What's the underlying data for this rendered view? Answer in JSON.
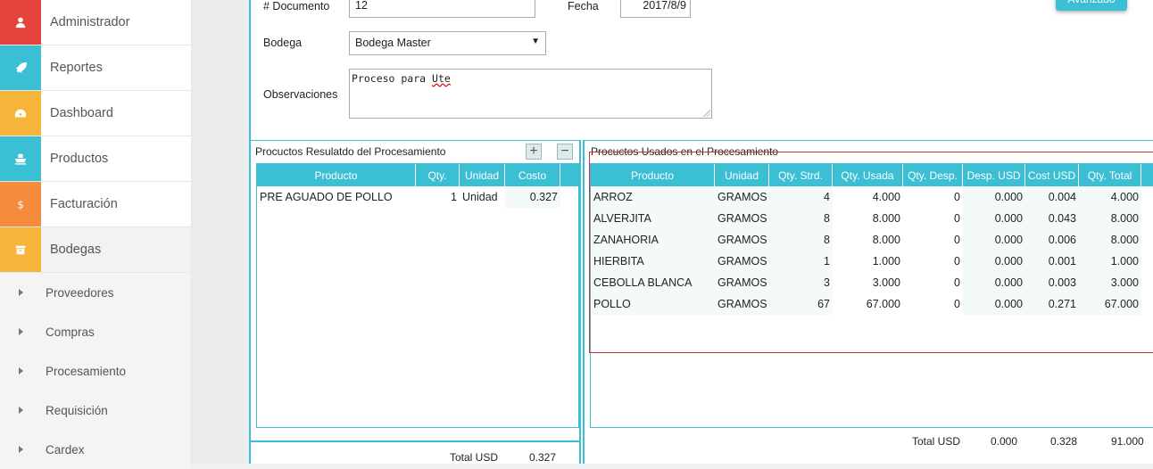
{
  "sidebar": {
    "items": [
      {
        "label": "Administrador",
        "icon": "user-icon",
        "color": "#e5443d"
      },
      {
        "label": "Reportes",
        "icon": "rocket-icon",
        "color": "#3bbfd4"
      },
      {
        "label": "Dashboard",
        "icon": "dashboard-icon",
        "color": "#f6b53a"
      },
      {
        "label": "Productos",
        "icon": "ship-icon",
        "color": "#3bbfd4"
      },
      {
        "label": "Facturación",
        "icon": "dollar-icon",
        "color": "#f58c3c"
      },
      {
        "label": "Bodegas",
        "icon": "archive-icon",
        "color": "#f6b53a"
      }
    ],
    "subitems": [
      "Proveedores",
      "Compras",
      "Procesamiento",
      "Requisición",
      "Cardex"
    ]
  },
  "form": {
    "documento_label": "# Documento",
    "documento_value": "12",
    "fecha_label": "Fecha",
    "fecha_value": "2017/8/9",
    "bodega_label": "Bodega",
    "bodega_value": "Bodega Master",
    "observaciones_label": "Observaciones",
    "observaciones_value_1": "Proceso para ",
    "observaciones_value_2": "Ute",
    "avanzado_label": "Avanzado"
  },
  "resultado": {
    "title": "Procuctos Resulatdo del Procesamiento",
    "add_symbol": "+",
    "remove_symbol": "−",
    "columns": [
      "Producto",
      "Qty.",
      "Unidad",
      "Costo"
    ],
    "rows": [
      {
        "producto": "PRE AGUADO DE POLLO",
        "qty": "1",
        "unidad": "Unidad",
        "costo": "0.327"
      }
    ],
    "total_label": "Total USD",
    "total_value": "0.327"
  },
  "usados": {
    "title": "Procuctos Usados en el Procesamiento",
    "columns": [
      "Producto",
      "Unidad",
      "Qty. Strd.",
      "Qty. Usada",
      "Qty. Desp.",
      "Desp. USD",
      "Cost USD",
      "Qty. Total"
    ],
    "rows": [
      {
        "producto": "ARROZ",
        "unidad": "GRAMOS",
        "strd": "4",
        "usada": "4.000",
        "desp": "0",
        "desp_usd": "0.000",
        "cost": "0.004",
        "total": "4.000"
      },
      {
        "producto": "ALVERJITA",
        "unidad": "GRAMOS",
        "strd": "8",
        "usada": "8.000",
        "desp": "0",
        "desp_usd": "0.000",
        "cost": "0.043",
        "total": "8.000"
      },
      {
        "producto": "ZANAHORIA",
        "unidad": "GRAMOS",
        "strd": "8",
        "usada": "8.000",
        "desp": "0",
        "desp_usd": "0.000",
        "cost": "0.006",
        "total": "8.000"
      },
      {
        "producto": "HIERBITA",
        "unidad": "GRAMOS",
        "strd": "1",
        "usada": "1.000",
        "desp": "0",
        "desp_usd": "0.000",
        "cost": "0.001",
        "total": "1.000"
      },
      {
        "producto": "CEBOLLA BLANCA",
        "unidad": "GRAMOS",
        "strd": "3",
        "usada": "3.000",
        "desp": "0",
        "desp_usd": "0.000",
        "cost": "0.003",
        "total": "3.000"
      },
      {
        "producto": "POLLO",
        "unidad": "GRAMOS",
        "strd": "67",
        "usada": "67.000",
        "desp": "0",
        "desp_usd": "0.000",
        "cost": "0.271",
        "total": "67.000"
      }
    ],
    "total_label": "Total USD",
    "total_desp_usd": "0.000",
    "total_cost": "0.328",
    "total_qty": "91.000"
  }
}
